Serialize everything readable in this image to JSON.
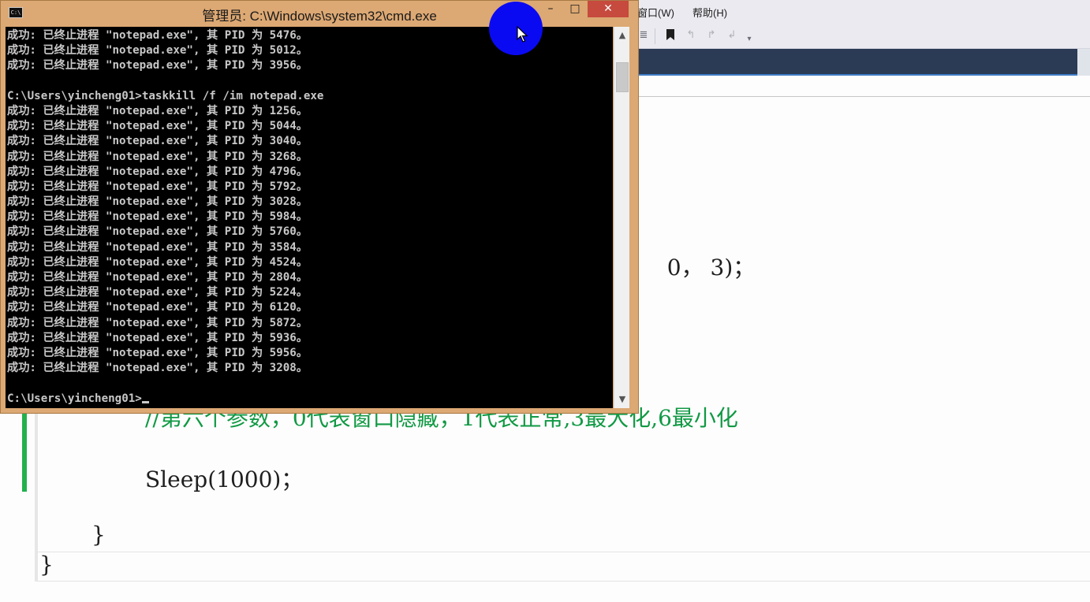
{
  "ide": {
    "menu": {
      "window": "窗口(W)",
      "help": "帮助(H)"
    },
    "toolbar_icons": [
      "align-icon",
      "bookmark-icon",
      "bookmark-prev-icon",
      "bookmark-next-icon",
      "bookmark-clear-icon",
      "overflow-icon"
    ],
    "code": {
      "line_args_tail": "，  0， 3)；",
      "comment": "//第六个参数，0代表窗口隐藏，1代表正常,3最大化,6最小化",
      "sleep": "Sleep(1000)；",
      "inner_brace": "}",
      "outer_brace": "}"
    }
  },
  "cmd": {
    "title": "管理员: C:\\Windows\\system32\\cmd.exe",
    "buttons": {
      "minimize": "–",
      "maximize": "□",
      "close": "✕"
    },
    "lines": [
      "成功: 已终止进程 \"notepad.exe\", 其 PID 为 5476。",
      "成功: 已终止进程 \"notepad.exe\", 其 PID 为 5012。",
      "成功: 已终止进程 \"notepad.exe\", 其 PID 为 3956。",
      "",
      "C:\\Users\\yincheng01>taskkill /f /im notepad.exe",
      "成功: 已终止进程 \"notepad.exe\", 其 PID 为 1256。",
      "成功: 已终止进程 \"notepad.exe\", 其 PID 为 5044。",
      "成功: 已终止进程 \"notepad.exe\", 其 PID 为 3040。",
      "成功: 已终止进程 \"notepad.exe\", 其 PID 为 3268。",
      "成功: 已终止进程 \"notepad.exe\", 其 PID 为 4796。",
      "成功: 已终止进程 \"notepad.exe\", 其 PID 为 5792。",
      "成功: 已终止进程 \"notepad.exe\", 其 PID 为 3028。",
      "成功: 已终止进程 \"notepad.exe\", 其 PID 为 5984。",
      "成功: 已终止进程 \"notepad.exe\", 其 PID 为 5760。",
      "成功: 已终止进程 \"notepad.exe\", 其 PID 为 3584。",
      "成功: 已终止进程 \"notepad.exe\", 其 PID 为 4524。",
      "成功: 已终止进程 \"notepad.exe\", 其 PID 为 2804。",
      "成功: 已终止进程 \"notepad.exe\", 其 PID 为 5224。",
      "成功: 已终止进程 \"notepad.exe\", 其 PID 为 6120。",
      "成功: 已终止进程 \"notepad.exe\", 其 PID 为 5872。",
      "成功: 已终止进程 \"notepad.exe\", 其 PID 为 5936。",
      "成功: 已终止进程 \"notepad.exe\", 其 PID 为 5956。",
      "成功: 已终止进程 \"notepad.exe\", 其 PID 为 3208。",
      ""
    ],
    "prompt": "C:\\Users\\yincheng01>"
  },
  "colors": {
    "cmd_frame": "#dca873",
    "close_button": "#c74a3e",
    "console_bg": "#000000",
    "console_text": "#c8c8c8",
    "comment": "#119944",
    "click_highlight": "#0a0af2",
    "tab_strip": "#2b3a55"
  }
}
